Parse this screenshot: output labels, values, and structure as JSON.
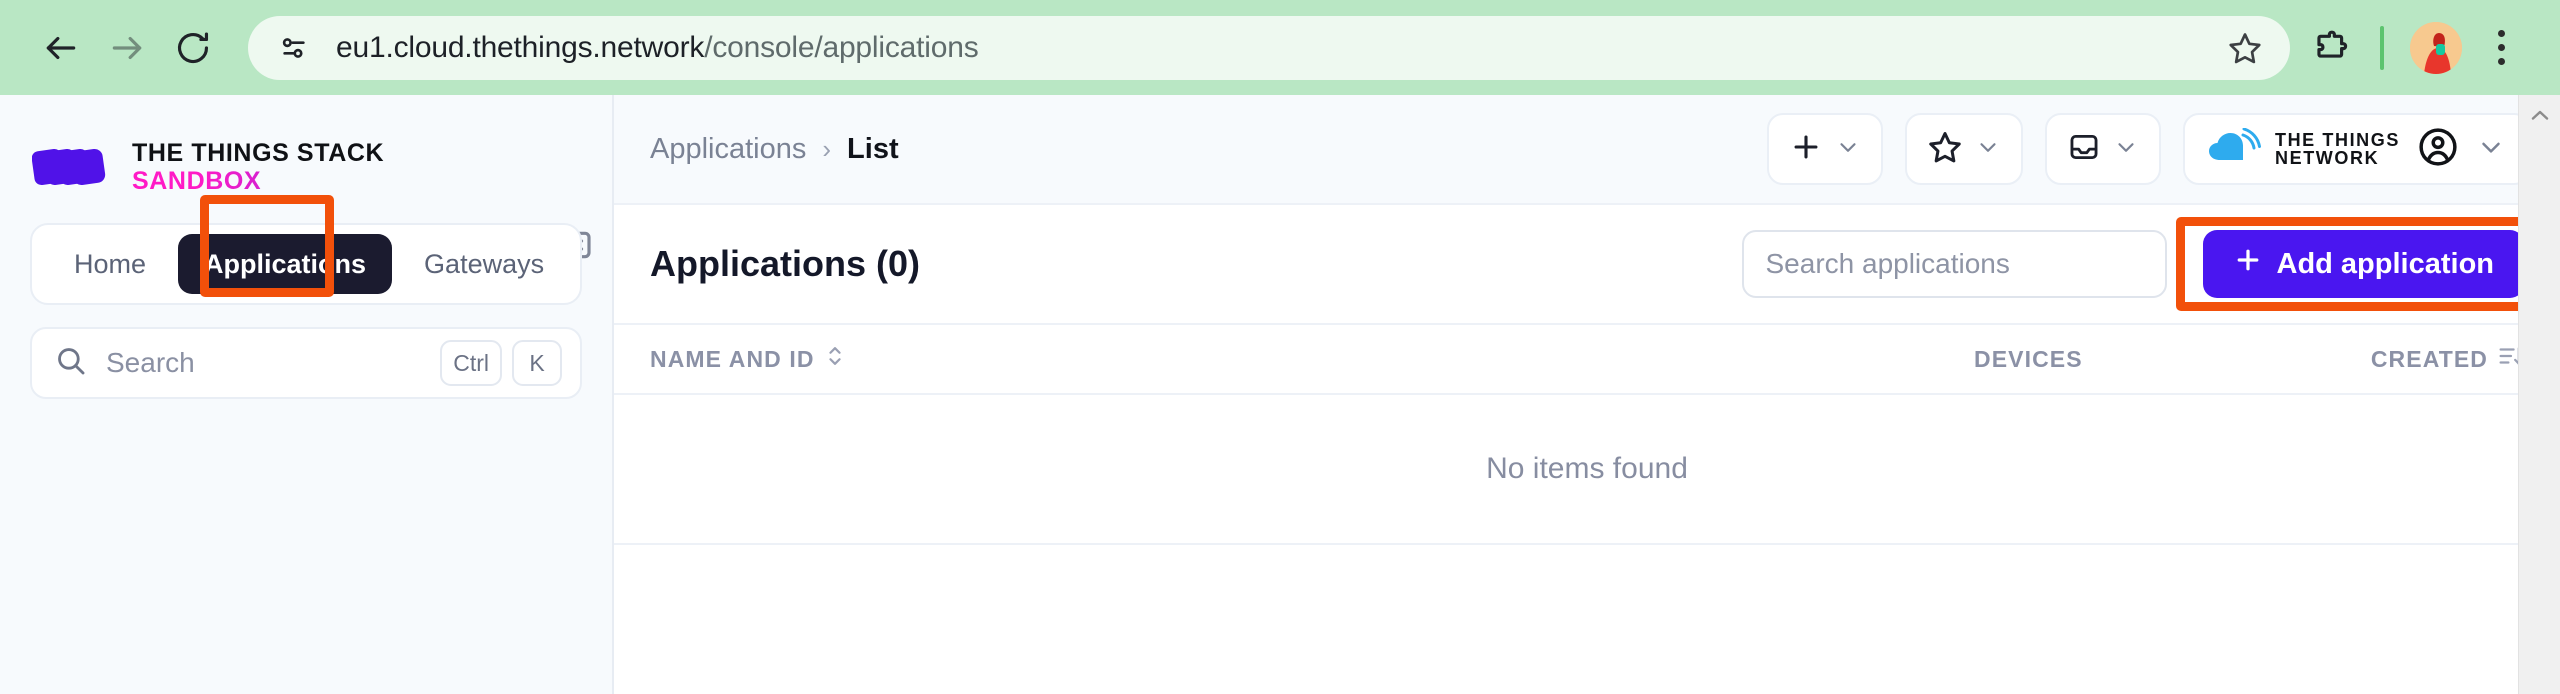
{
  "browser": {
    "back_label": "Back",
    "forward_label": "Forward",
    "reload_label": "Reload",
    "site_info_label": "site-settings",
    "url_host": "eu1.cloud.thethings.network",
    "url_path": "/console/applications",
    "bookmark_label": "Bookmark this tab",
    "extensions_label": "Extensions",
    "profile_label": "Profile",
    "menu_label": "Customize and control Chrome",
    "toolbar_bg": "#b9e7c4",
    "omnibox_bg": "#eef9f0"
  },
  "sidebar": {
    "logo": {
      "line1": "THE THINGS STACK",
      "line2": "SANDBOX",
      "mark_color": "#5012e8",
      "gradient_from": "#ff1ac6",
      "gradient_to": "#8a2be2"
    },
    "collapse_label": "Collapse sidebar",
    "tabs": [
      {
        "label": "Home",
        "active": false
      },
      {
        "label": "Applications",
        "active": true
      },
      {
        "label": "Gateways",
        "active": false
      }
    ],
    "search": {
      "placeholder": "Search",
      "shortcut_modifier": "Ctrl",
      "shortcut_key": "K"
    }
  },
  "header": {
    "breadcrumb": {
      "parent": "Applications",
      "separator": "›",
      "current": "List"
    },
    "actions": [
      {
        "name": "add-menu",
        "icon": "plus-icon"
      },
      {
        "name": "bookmarks-menu",
        "icon": "star-icon"
      },
      {
        "name": "notifications-menu",
        "icon": "inbox-icon"
      },
      {
        "name": "account-menu",
        "icon": "ttn-cloud-icon"
      }
    ],
    "network_logo": {
      "line1": "THE THINGS",
      "line2": "NETWORK",
      "cloud_color": "#2eabee"
    }
  },
  "main": {
    "title": "Applications (0)",
    "search_placeholder": "Search applications",
    "add_button_label": "Add application",
    "add_button_color": "#4a16f0",
    "table": {
      "columns": [
        {
          "label": "NAME AND ID",
          "sort": "sortable"
        },
        {
          "label": "DEVICES",
          "sort": "none"
        },
        {
          "label": "CREATED",
          "sort": "descending"
        }
      ],
      "empty_message": "No items found",
      "rows": []
    }
  },
  "annotations": {
    "highlight_color": "#f2500a",
    "boxes": [
      {
        "target": "Applications tab"
      },
      {
        "target": "Add application button"
      }
    ]
  }
}
